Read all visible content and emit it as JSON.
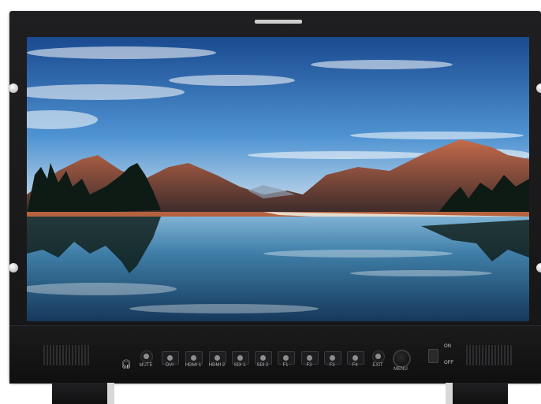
{
  "device": {
    "type": "broadcast-monitor",
    "screen_content": "mountain lake landscape"
  },
  "controls": {
    "headphone_icon": "headphone-icon",
    "buttons": [
      {
        "id": "mute",
        "label": "MUTE"
      },
      {
        "id": "dvi",
        "label": "DVI"
      },
      {
        "id": "hdmi1",
        "label": "HDMI 1"
      },
      {
        "id": "hdmi2",
        "label": "HDMI 2"
      },
      {
        "id": "sdi1",
        "label": "SDI 1"
      },
      {
        "id": "sdi2",
        "label": "SDI 2"
      },
      {
        "id": "f1",
        "label": "F1"
      },
      {
        "id": "f2",
        "label": "F2"
      },
      {
        "id": "f3",
        "label": "F3"
      },
      {
        "id": "f4",
        "label": "F4"
      },
      {
        "id": "exit",
        "label": "EXIT"
      },
      {
        "id": "menu",
        "label": "MENU"
      }
    ],
    "power": {
      "on_label": "ON",
      "off_label": "OFF"
    }
  },
  "colors": {
    "bezel": "#1a1a1b",
    "sky_top": "#1b4f93",
    "sky_bottom": "#8fc3ec",
    "mountain": "#7a3b2e",
    "water": "#2a6a93"
  }
}
